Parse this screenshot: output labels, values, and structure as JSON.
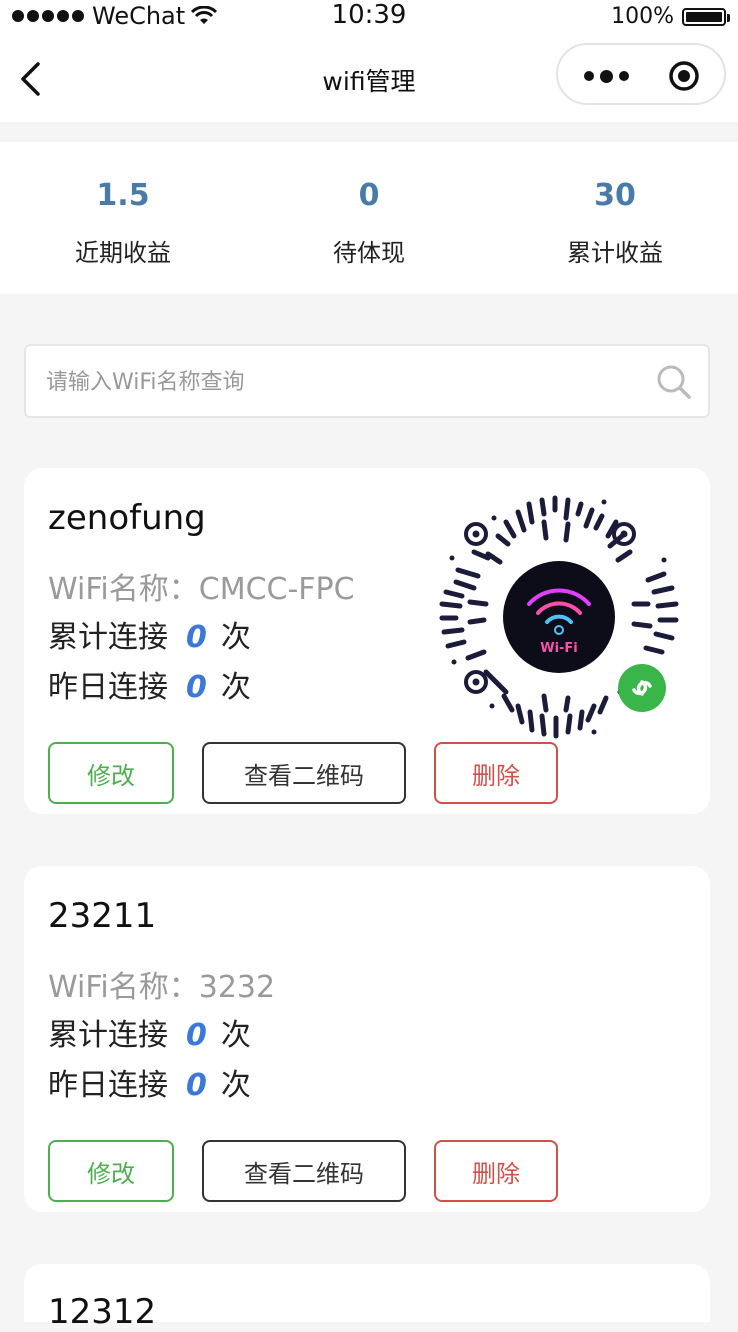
{
  "status_bar": {
    "carrier": "WeChat",
    "time": "10:39",
    "battery": "100%",
    "battery_level": 1.0
  },
  "nav": {
    "title": "wifi管理"
  },
  "stats": [
    {
      "value": "1.5",
      "label": "近期收益"
    },
    {
      "value": "0",
      "label": "待体现"
    },
    {
      "value": "30",
      "label": "累计收益"
    }
  ],
  "search": {
    "placeholder": "请输入WiFi名称查询"
  },
  "cards": [
    {
      "title": "zenofung",
      "ssid_label": "WiFi名称：",
      "ssid": "CMCC-FPC",
      "total_label": "累计连接",
      "total_count": "0",
      "yesterday_label": "昨日连接",
      "yesterday_count": "0",
      "unit": "次",
      "qr_text": "Wi-Fi"
    },
    {
      "title": "23211",
      "ssid_label": "WiFi名称：",
      "ssid": "3232",
      "total_label": "累计连接",
      "total_count": "0",
      "yesterday_label": "昨日连接",
      "yesterday_count": "0",
      "unit": "次"
    },
    {
      "title": "12312"
    }
  ],
  "buttons": {
    "edit": "修改",
    "view_qr": "查看二维码",
    "delete": "删除"
  },
  "colors": {
    "stat_value": "#4a7aa8",
    "count": "#3c78d8",
    "edit": "#4caf50",
    "delete": "#d0504a"
  }
}
